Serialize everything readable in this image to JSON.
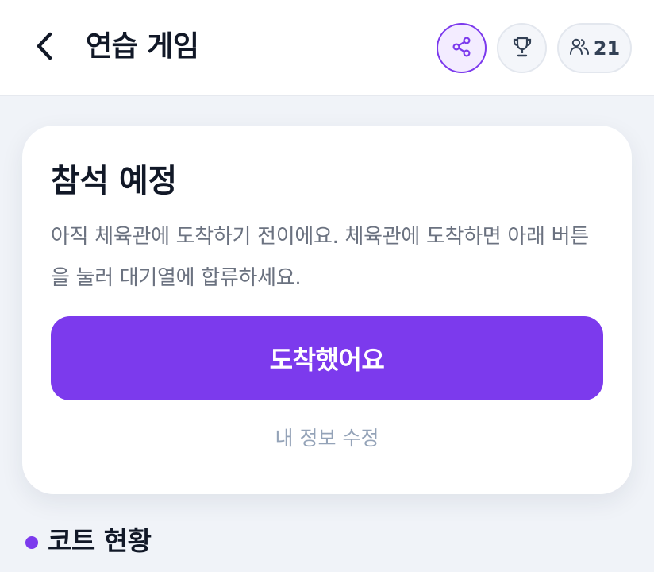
{
  "header": {
    "title": "연습 게임",
    "players_count": "21",
    "icons": {
      "back": "chevron-left-icon",
      "share": "share-icon",
      "trophy": "trophy-icon",
      "players": "users-icon"
    }
  },
  "card": {
    "title": "참석 예정",
    "description": "아직 체육관에 도착하기 전이에요. 체육관에 도착하면 아래 버튼을 눌러 대기열에 합류하세요.",
    "primary_button": "도착했어요",
    "secondary_link": "내 정보 수정"
  },
  "section": {
    "title": "코트 현황"
  },
  "colors": {
    "accent": "#7c3aed",
    "background": "#f0f3f8",
    "card": "#ffffff",
    "text_primary": "#111827",
    "text_secondary": "#6b7280",
    "text_muted": "#94a3b8"
  }
}
